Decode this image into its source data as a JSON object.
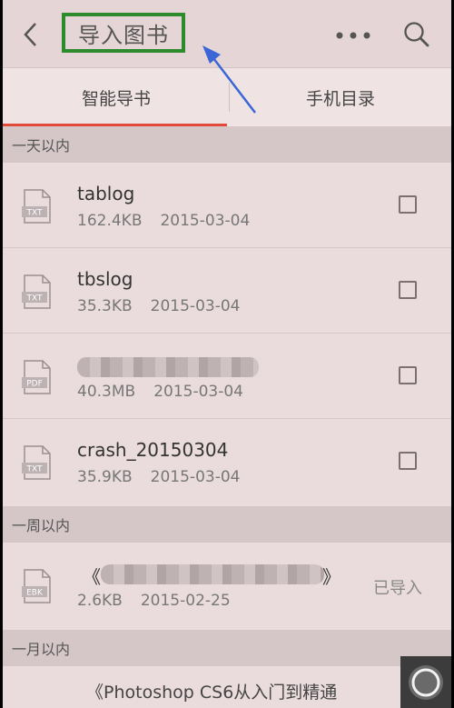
{
  "header": {
    "title": "导入图书",
    "icons": {
      "back": "chevron-left-icon",
      "more": "more-dots-icon",
      "search": "search-icon"
    },
    "highlight_color": "#2d8a2d",
    "arrow_color": "#3a66d6"
  },
  "tabs": [
    {
      "label": "智能导书",
      "active": true
    },
    {
      "label": "手机目录",
      "active": false
    }
  ],
  "accent_color": "#e24a3b",
  "sections": [
    {
      "title": "一天以内",
      "files": [
        {
          "name": "tablog",
          "type": "TXT",
          "size": "162.4KB",
          "date": "2015-03-04",
          "status": "checkbox"
        },
        {
          "name": "tbslog",
          "type": "TXT",
          "size": "35.3KB",
          "date": "2015-03-04",
          "status": "checkbox"
        },
        {
          "name": "",
          "type": "PDF",
          "size": "40.3MB",
          "date": "2015-03-04",
          "status": "checkbox",
          "name_blurred": true
        },
        {
          "name": "crash_20150304",
          "type": "TXT",
          "size": "35.9KB",
          "date": "2015-03-04",
          "status": "checkbox"
        }
      ]
    },
    {
      "title": "一周以内",
      "files": [
        {
          "name_prefix": "《",
          "name_suffix": "》",
          "type": "EBK",
          "size": "2.6KB",
          "date": "2015-02-25",
          "status": "已导入",
          "name_blurred": true
        }
      ]
    },
    {
      "title": "一月以内",
      "files": [
        {
          "name": "《Photoshop CS6从入门到精通",
          "partial": true
        }
      ]
    }
  ]
}
